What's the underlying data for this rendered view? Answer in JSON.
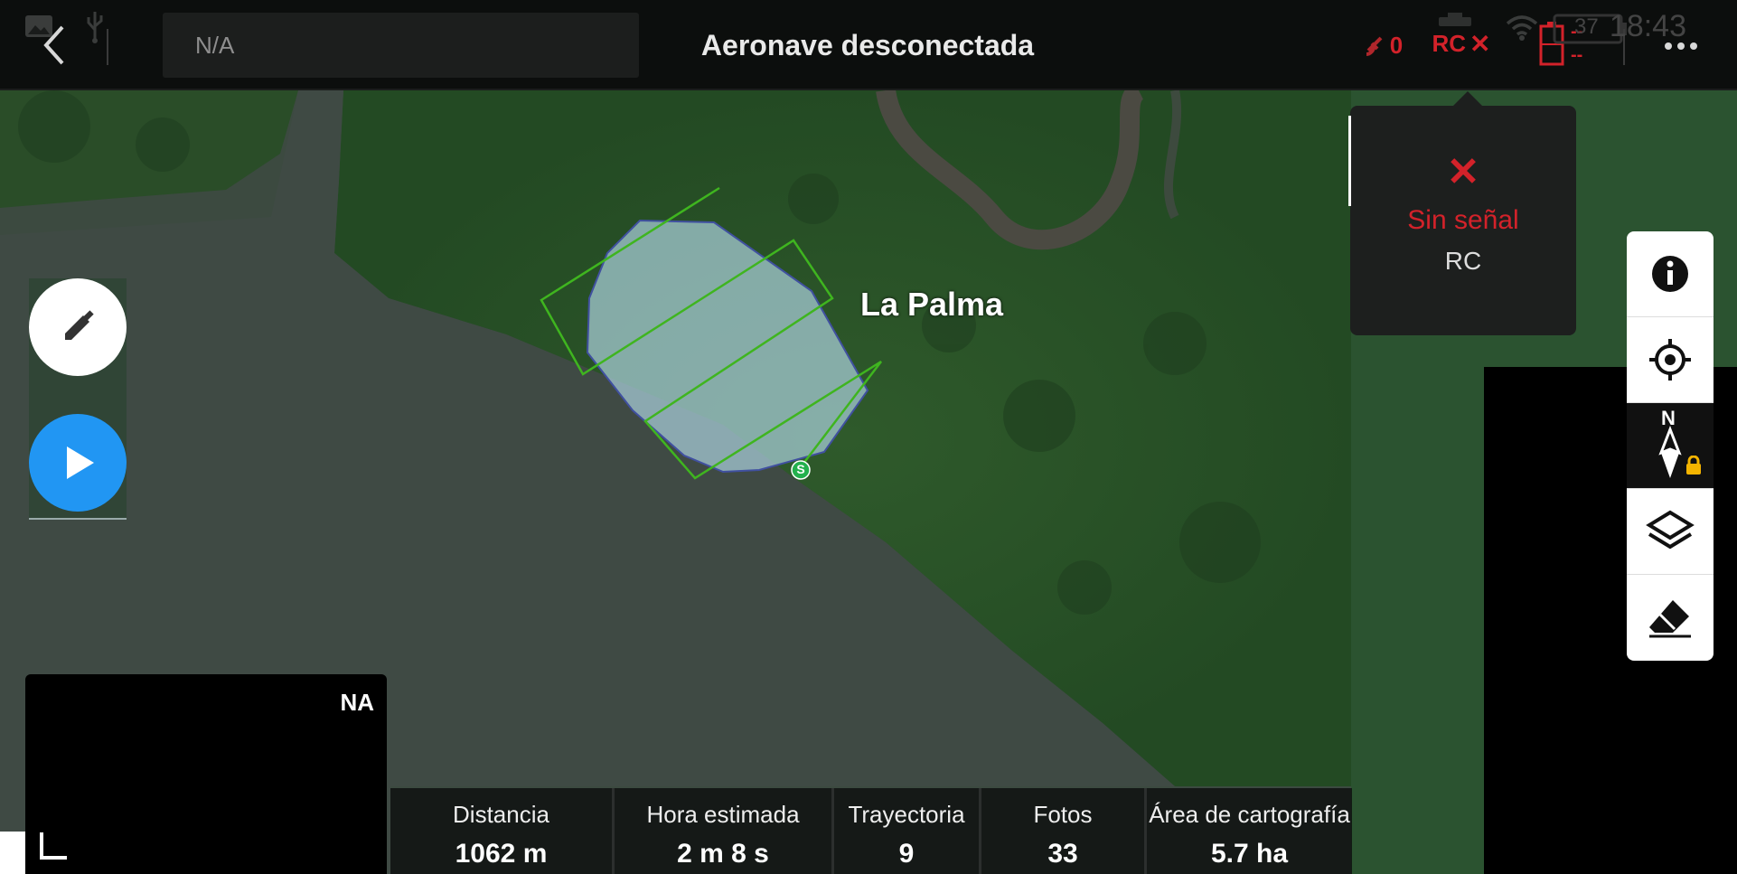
{
  "header": {
    "back_label": "",
    "search_value": "N/A",
    "title": "Aeronave desconectada",
    "satellite_count": "0",
    "rc_label": "RC",
    "battery_top": "--",
    "battery_bottom": "--",
    "battery_percent": "37",
    "time": "18:43"
  },
  "map": {
    "place_label": "La Palma",
    "start_marker": "S"
  },
  "popup": {
    "status": "Sin señal",
    "source": "RC"
  },
  "compass": {
    "north_label": "N"
  },
  "minimap": {
    "corner_label": "NA"
  },
  "stats": [
    {
      "label": "Distancia",
      "value": "1062 m"
    },
    {
      "label": "Hora estimada",
      "value": "2 m 8 s"
    },
    {
      "label": "Trayectoria",
      "value": "9"
    },
    {
      "label": "Fotos",
      "value": "33"
    },
    {
      "label": "Área de cartografía",
      "value": "5.7 ha"
    }
  ],
  "colors": {
    "accent_red": "#d3222a",
    "play_blue": "#2196f3",
    "flight_path_green": "#3fb51f",
    "area_fill": "#a9cfd9"
  }
}
